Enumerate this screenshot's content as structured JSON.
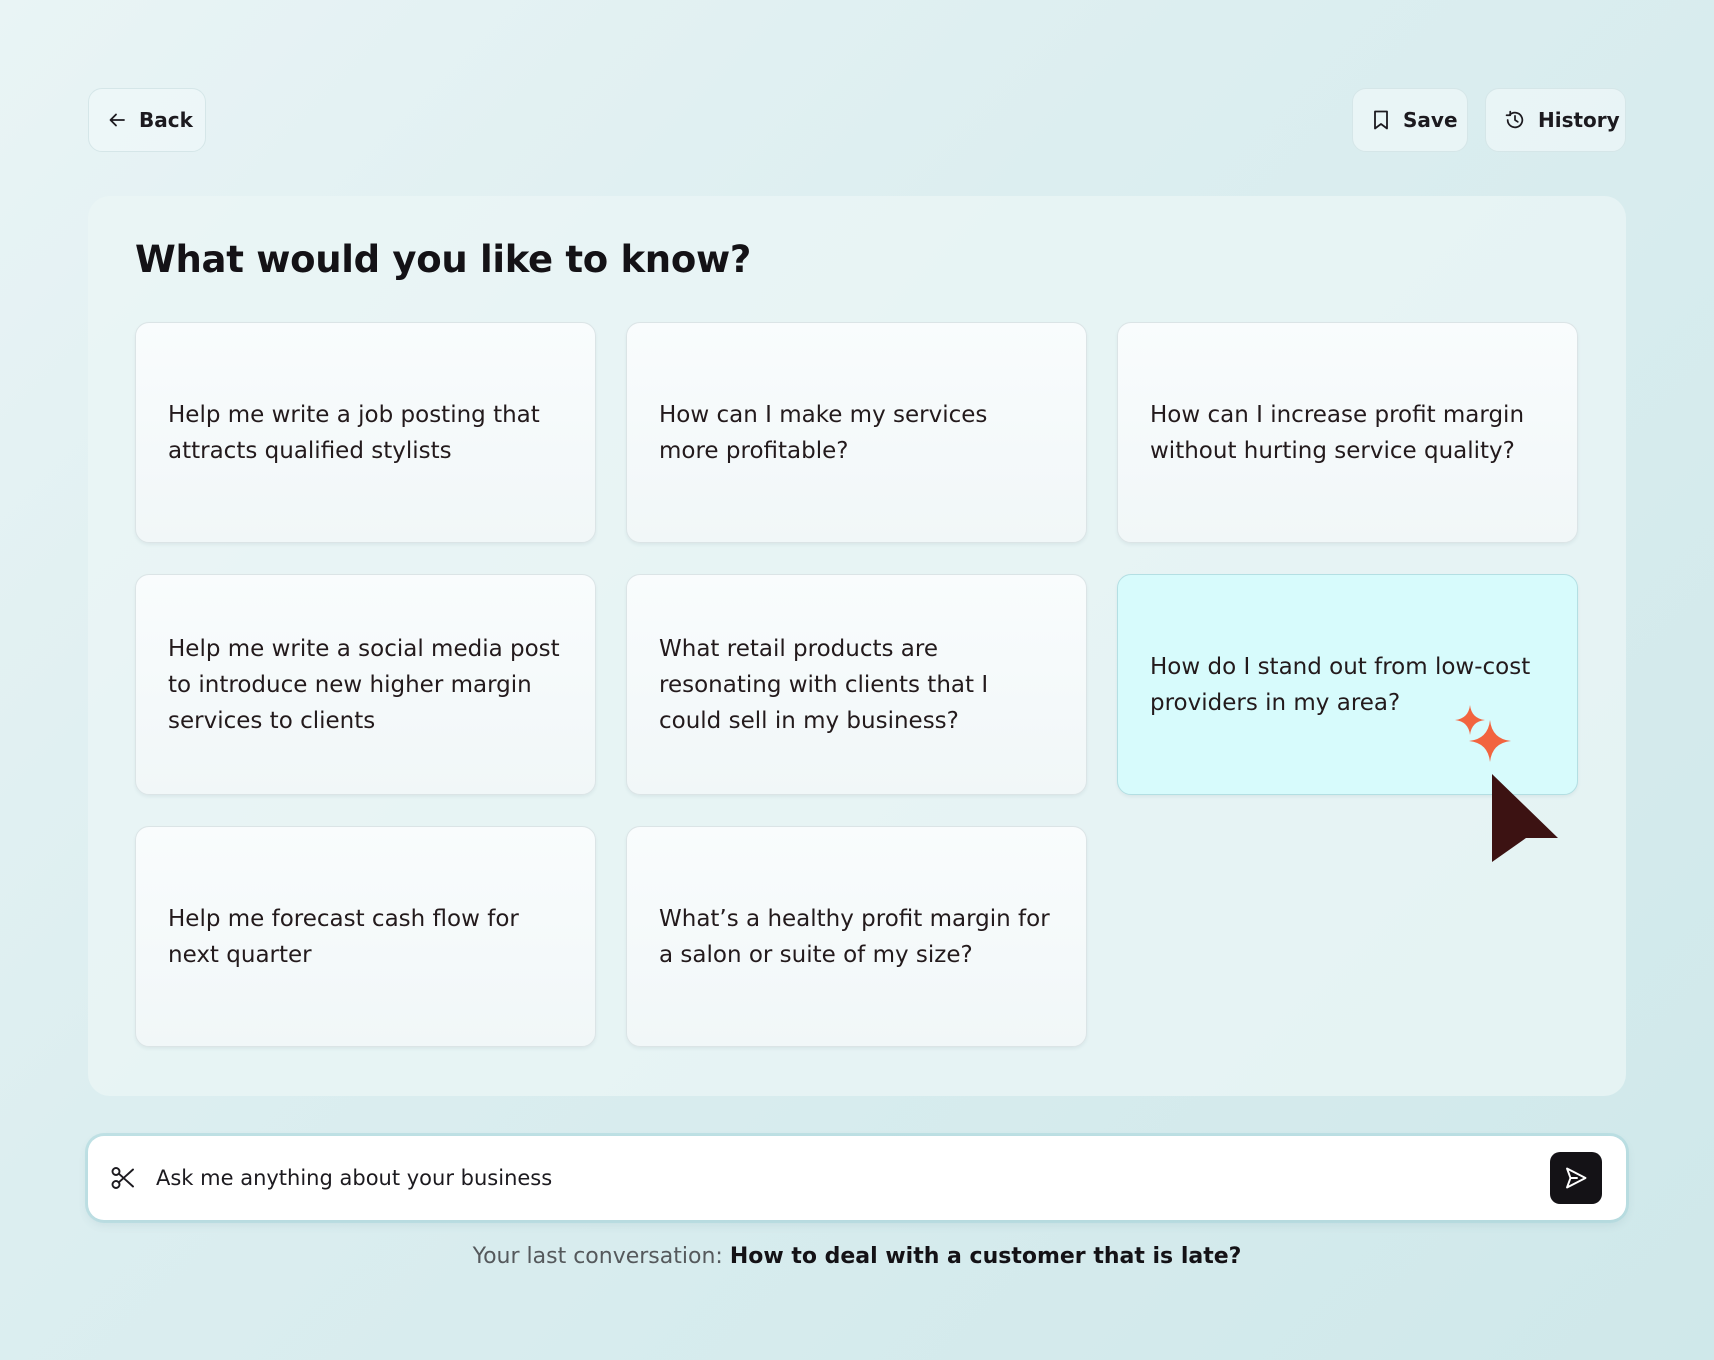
{
  "header": {
    "back_label": "Back",
    "save_label": "Save",
    "history_label": "History"
  },
  "main": {
    "title": "What would you like to know?",
    "suggestions": [
      {
        "text": "Help me write a job posting that attracts qualified stylists"
      },
      {
        "text": "How can I make my services more profitable?"
      },
      {
        "text": "How can I increase profit margin without hurting service quality?"
      },
      {
        "text": "Help me write a social media post to introduce new higher margin services to clients"
      },
      {
        "text": "What retail products are resonating with clients that I could sell in my business?"
      },
      {
        "text": "How do I stand out from low-cost providers in my area?",
        "highlighted": true
      },
      {
        "text": "Help me forecast cash flow for next quarter"
      },
      {
        "text": "What’s a healthy profit margin for a salon or suite of my size?"
      }
    ]
  },
  "ask": {
    "placeholder": "Ask me anything about your business",
    "icon": "scissors-icon",
    "send_icon": "send-icon"
  },
  "last_conversation": {
    "prefix": "Your last conversation:",
    "title": "How to deal with a customer that is late?"
  },
  "colors": {
    "accent_dark": "#141216",
    "highlight_card": "#d7fbfc",
    "sparkle": "#f2643f",
    "cursor": "#3c1212"
  }
}
